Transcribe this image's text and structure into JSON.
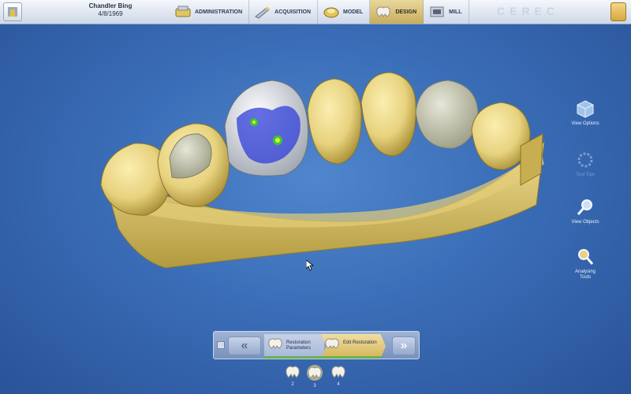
{
  "patient": {
    "name": "Chandler Bing",
    "date": "4/8/1969"
  },
  "nav": [
    {
      "label": "ADMINISTRATION",
      "icon": "administration-icon",
      "active": false
    },
    {
      "label": "ACQUISITION",
      "icon": "acquisition-camera-icon",
      "active": false
    },
    {
      "label": "MODEL",
      "icon": "model-icon",
      "active": false
    },
    {
      "label": "DESIGN",
      "icon": "design-tooth-icon",
      "active": true
    },
    {
      "label": "MILL",
      "icon": "mill-icon",
      "active": false
    }
  ],
  "brand": "CEREC",
  "tools": [
    {
      "label": "View Options",
      "icon": "view-options-cube-icon",
      "enabled": true
    },
    {
      "label": "Tool Tips",
      "icon": "tool-tips-ring-icon",
      "enabled": false
    },
    {
      "label": "View Objects",
      "icon": "view-objects-magnifier-icon",
      "enabled": true
    },
    {
      "label": "Analysing Tools",
      "icon": "analysing-tools-icon",
      "enabled": true
    }
  ],
  "workflow": {
    "back": "«",
    "forward": "»",
    "steps": [
      {
        "label": "Restoration Parameters",
        "active": false
      },
      {
        "label": "Edit Restoration",
        "active": true
      }
    ]
  },
  "restorations": [
    {
      "label": "2"
    },
    {
      "label": "3"
    },
    {
      "label": "4"
    }
  ],
  "colors": {
    "background": "#3a6db7",
    "model": "#e7d27e",
    "active_tab": "#d6b85e",
    "contact_map": "#2f3fd8"
  }
}
